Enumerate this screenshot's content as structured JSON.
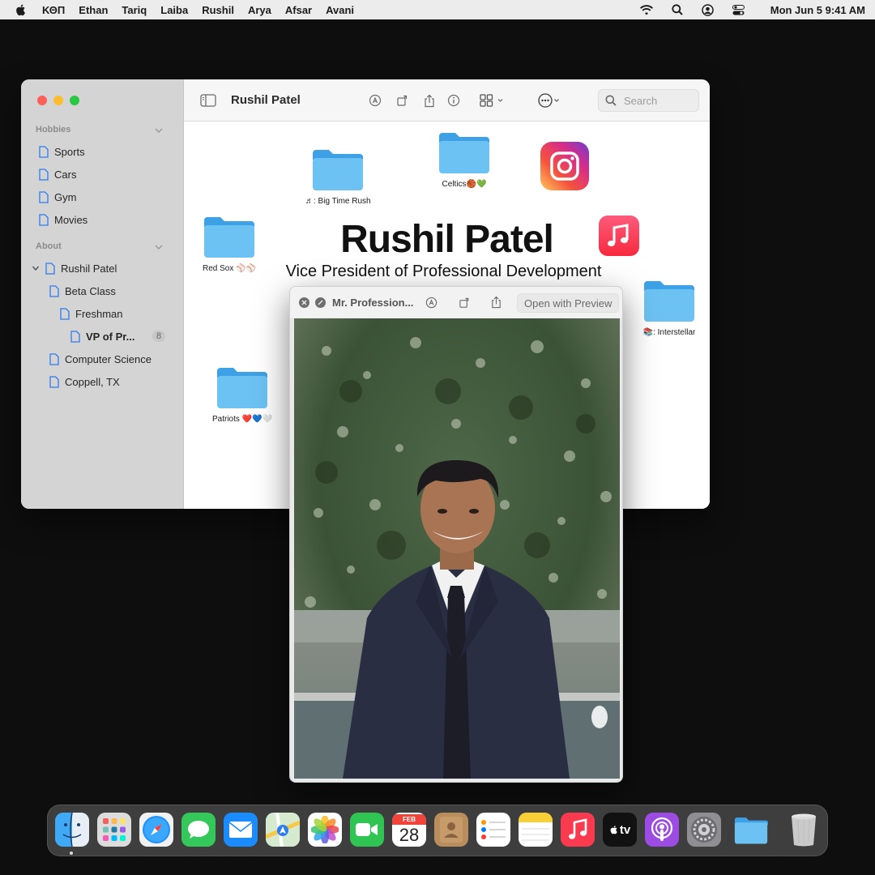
{
  "menubar": {
    "items": [
      "ΚΘΠ",
      "Ethan",
      "Tariq",
      "Laiba",
      "Rushil",
      "Arya",
      "Afsar",
      "Avani"
    ],
    "clock": "Mon Jun 5  9:41 AM"
  },
  "finder": {
    "title": "Rushil Patel",
    "search_placeholder": "Search",
    "sidebar": {
      "section_hobbies": "Hobbies",
      "hobbies": [
        "Sports",
        "Cars",
        "Gym",
        "Movies"
      ],
      "section_about": "About",
      "about_root": "Rushil Patel",
      "beta_class": "Beta Class",
      "freshman": "Freshman",
      "vp": "VP of Pr...",
      "vp_count": "8",
      "computer_science": "Computer Science",
      "location": "Coppell, TX"
    },
    "content": {
      "name": "Rushil Patel",
      "subtitle": "Vice President of Professional Development",
      "folders": {
        "big_time_rush": "♬: Big Time Rush",
        "celtics": "Celtics🏀💚",
        "red_sox": "Red Sox ⚾⚾",
        "interstellar": "📚: Interstellar",
        "patriots": "Patriots ❤️💙🤍"
      }
    }
  },
  "quicklook": {
    "title": "Mr. Profession...",
    "open_with": "Open with Preview"
  },
  "dock": {
    "calendar_month": "FEB",
    "calendar_day": "28",
    "tv_label": "tv"
  }
}
